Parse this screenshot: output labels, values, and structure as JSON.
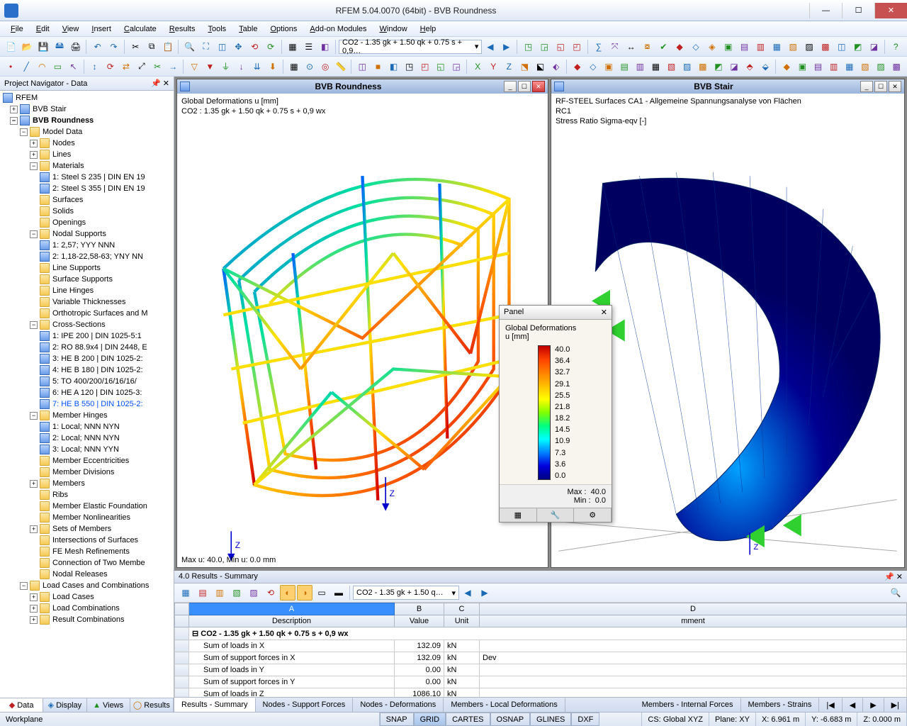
{
  "window": {
    "title": "RFEM 5.04.0070 (64bit) - BVB Roundness",
    "min": "—",
    "max": "☐",
    "close": "✕"
  },
  "menu": [
    "File",
    "Edit",
    "View",
    "Insert",
    "Calculate",
    "Results",
    "Tools",
    "Table",
    "Options",
    "Add-on Modules",
    "Window",
    "Help"
  ],
  "toolbar_combo": "CO2 - 1.35 gk + 1.50 qk + 0.75 s + 0,9…",
  "navigator": {
    "title": "Project Navigator - Data",
    "root": "RFEM",
    "m1": "BVB Stair",
    "m2": "BVB Roundness",
    "modeldata": "Model Data",
    "items": [
      "Nodes",
      "Lines",
      "Materials",
      "1: Steel S 235 | DIN EN 19",
      "2: Steel S 355 | DIN EN 19",
      "Surfaces",
      "Solids",
      "Openings",
      "Nodal Supports",
      "1: 2,57; YYY NNN",
      "2: 1,18-22,58-63; YNY NN",
      "Line Supports",
      "Surface Supports",
      "Line Hinges",
      "Variable Thicknesses",
      "Orthotropic Surfaces and M",
      "Cross-Sections",
      "1: IPE 200 | DIN 1025-5:1",
      "2: RO 88.9x4 | DIN 2448, E",
      "3: HE B 200 | DIN 1025-2:",
      "4: HE B 180 | DIN 1025-2:",
      "5: TO 400/200/16/16/16/",
      "6: HE A 120 | DIN 1025-3:",
      "7: HE B 550 | DIN 1025-2:",
      "Member Hinges",
      "1: Local; NNN NYN",
      "2: Local; NNN NYN",
      "3: Local; NNN YYN",
      "Member Eccentricities",
      "Member Divisions",
      "Members",
      "Ribs",
      "Member Elastic Foundation",
      "Member Nonlinearities",
      "Sets of Members",
      "Intersections of Surfaces",
      "FE Mesh Refinements",
      "Connection of Two Membe",
      "Nodal Releases"
    ],
    "lcc": "Load Cases and Combinations",
    "lcc_items": [
      "Load Cases",
      "Load Combinations",
      "Result Combinations"
    ],
    "tabs": [
      "Data",
      "Display",
      "Views",
      "Results"
    ]
  },
  "view1": {
    "title": "BVB Roundness",
    "line1": "Global Deformations u [mm]",
    "line2": "CO2 : 1.35 gk + 1.50 qk + 0.75 s + 0,9 wx",
    "footer": "Max u: 40.0, Min u: 0.0 mm"
  },
  "view2": {
    "title": "BVB Stair",
    "line1": "RF-STEEL Surfaces CA1 - Allgemeine Spannungsanalyse von Flächen",
    "line2": "RC1",
    "line3": "Stress Ratio Sigma-eqv [-]"
  },
  "panel": {
    "title": "Panel",
    "heading": "Global Deformations",
    "unit": "u [mm]",
    "values": [
      "40.0",
      "36.4",
      "32.7",
      "29.1",
      "25.5",
      "21.8",
      "18.2",
      "14.5",
      "10.9",
      "7.3",
      "3.6",
      "0.0"
    ],
    "max_label": "Max  :",
    "max": "40.0",
    "min_label": "Min   :",
    "min": "0.0"
  },
  "results": {
    "title": "4.0 Results - Summary",
    "combo": "CO2 - 1.35 gk + 1.50 q…",
    "colA": "A",
    "colB": "B",
    "colC": "C",
    "colD": "D",
    "hDesc": "Description",
    "hVal": "Value",
    "hUnit": "Unit",
    "hComm": "mment",
    "group": "CO2 - 1.35 gk + 1.50 qk + 0.75 s + 0,9 wx",
    "rows": [
      {
        "d": "Sum of loads in X",
        "v": "132.09",
        "u": "kN",
        "c": ""
      },
      {
        "d": "Sum of support forces in X",
        "v": "132.09",
        "u": "kN",
        "c": "Dev"
      },
      {
        "d": "Sum of loads in Y",
        "v": "0.00",
        "u": "kN",
        "c": ""
      },
      {
        "d": "Sum of support forces in Y",
        "v": "0.00",
        "u": "kN",
        "c": ""
      },
      {
        "d": "Sum of loads in Z",
        "v": "1086.10",
        "u": "kN",
        "c": ""
      }
    ],
    "tabs": [
      "Results - Summary",
      "Nodes - Support Forces",
      "Nodes - Deformations",
      "Members - Local Deformations"
    ],
    "tabs2": [
      "Members - Internal Forces",
      "Members - Strains"
    ]
  },
  "status": {
    "workplane": "Workplane",
    "toggles": [
      "SNAP",
      "GRID",
      "CARTES",
      "OSNAP",
      "GLINES",
      "DXF"
    ],
    "cs": "CS: Global XYZ",
    "plane": "Plane: XY",
    "x": "X: 6.961 m",
    "y": "Y: -6.683 m",
    "z": "Z: 0.000 m"
  }
}
